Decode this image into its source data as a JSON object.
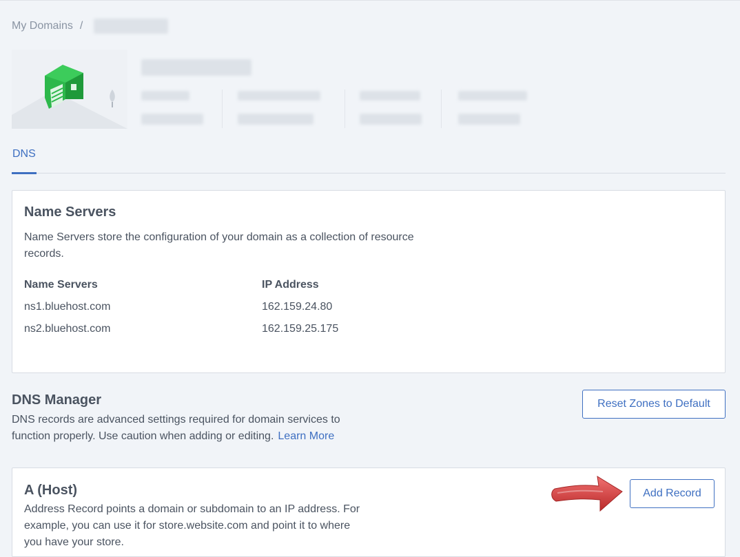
{
  "breadcrumb": {
    "root": "My Domains",
    "separator": "/"
  },
  "tabs": [
    {
      "label": "DNS",
      "active": true
    }
  ],
  "name_servers": {
    "title": "Name Servers",
    "description": "Name Servers store the configuration of your domain as a collection of resource records.",
    "columns": {
      "name": "Name Servers",
      "ip": "IP Address"
    },
    "rows": [
      {
        "name": "ns1.bluehost.com",
        "ip": "162.159.24.80"
      },
      {
        "name": "ns2.bluehost.com",
        "ip": "162.159.25.175"
      }
    ]
  },
  "dns_manager": {
    "title": "DNS Manager",
    "description": "DNS records are advanced settings required for domain services to function properly. Use caution when adding or editing.",
    "learn_more": "Learn More",
    "reset_button": "Reset Zones to Default"
  },
  "a_host": {
    "title": "A (Host)",
    "description": "Address Record points a domain or subdomain to an IP address. For example, you can use it for store.website.com and point it to where you have your store.",
    "add_button": "Add Record"
  },
  "icons": {
    "domain_illustration": "house-icon",
    "callout": "red-arrow-icon"
  },
  "colors": {
    "accent": "#3e6fc1",
    "background": "#f1f4f8",
    "arrow": "#d33333",
    "house": "#2db84b"
  }
}
